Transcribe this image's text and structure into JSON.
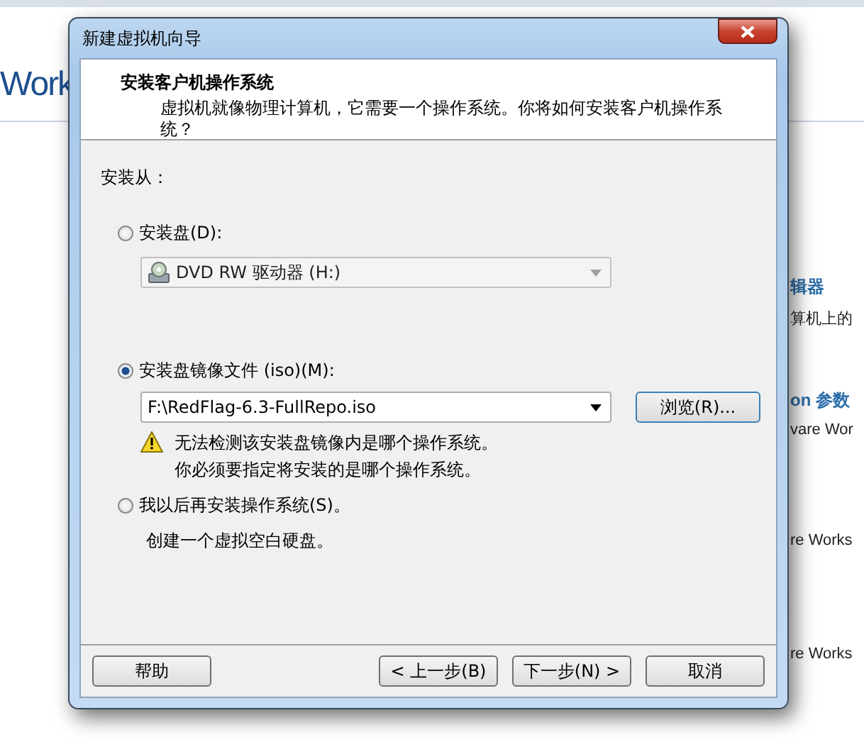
{
  "background": {
    "heading": "Work",
    "sections": [
      {
        "title": "辑器",
        "text": "算机上的"
      },
      {
        "title": "on 参数",
        "text": "vare Wor"
      },
      {
        "text": "re Works"
      },
      {
        "text": "re Works"
      }
    ]
  },
  "dialog": {
    "title": "新建虚拟机向导",
    "header": {
      "title": "安装客户机操作系统",
      "description": "虚拟机就像物理计算机，它需要一个操作系统。你将如何安装客户机操作系统？"
    },
    "source_label": "安装从：",
    "options": [
      {
        "kind": "drive",
        "label": "安装盘(D):",
        "selected": false,
        "value": "DVD RW 驱动器 (H:)",
        "disabled": true
      },
      {
        "kind": "iso",
        "label": "安装盘镜像文件 (iso)(M):",
        "selected": true,
        "value": "F:\\RedFlag-6.3-FullRepo.iso",
        "browse": "浏览(R)...",
        "warning": [
          "无法检测该安装盘镜像内是哪个操作系统。",
          "你必须要指定将安装的是哪个操作系统。"
        ]
      },
      {
        "kind": "later",
        "label": "我以后再安装操作系统(S)。",
        "selected": false,
        "note": "创建一个虚拟空白硬盘。"
      }
    ],
    "buttons": [
      {
        "kind": "help",
        "label": "帮助"
      },
      {
        "kind": "back",
        "label": "< 上一步(B)"
      },
      {
        "kind": "next",
        "label": "下一步(N) >"
      },
      {
        "kind": "cancel",
        "label": "取消"
      }
    ]
  }
}
